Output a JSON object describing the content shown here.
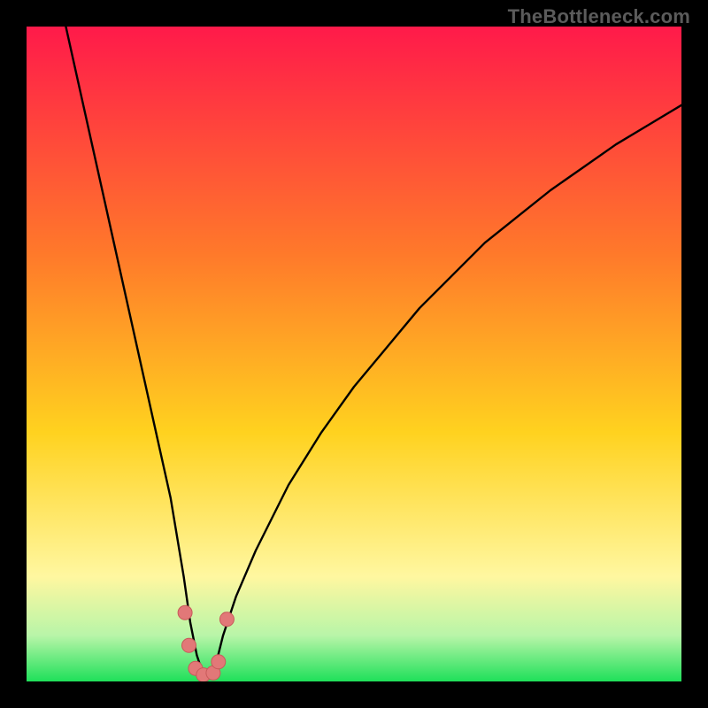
{
  "watermark": "TheBottleneck.com",
  "colors": {
    "frame": "#000000",
    "grad_top": "#ff1a4a",
    "grad_mid_upper": "#ff7a2a",
    "grad_mid": "#ffd21f",
    "grad_yellow_pale": "#fff7a0",
    "grad_green_pale": "#b8f5a8",
    "grad_green": "#1fe05a",
    "curve": "#000000",
    "marker_fill": "#e27878",
    "marker_stroke": "#c85a5a"
  },
  "chart_data": {
    "type": "line",
    "title": "",
    "xlabel": "",
    "ylabel": "",
    "xlim": [
      0,
      100
    ],
    "ylim": [
      0,
      100
    ],
    "note": "Axes are unlabeled; x is arbitrary range 0–100, y is 0 (bottom, green) to 100 (top, red). Curve is a steep V with minimum near x≈27, shallower rise to the right.",
    "series": [
      {
        "name": "bottleneck-curve",
        "x": [
          6,
          8,
          10,
          12,
          14,
          16,
          18,
          20,
          22,
          24,
          25,
          26,
          27,
          28,
          29,
          30,
          32,
          35,
          40,
          45,
          50,
          55,
          60,
          65,
          70,
          75,
          80,
          85,
          90,
          95,
          100
        ],
        "y": [
          100,
          91,
          82,
          73,
          64,
          55,
          46,
          37,
          28,
          16,
          9,
          4,
          1,
          1,
          3,
          7,
          13,
          20,
          30,
          38,
          45,
          51,
          57,
          62,
          67,
          71,
          75,
          78.5,
          82,
          85,
          88
        ]
      }
    ],
    "markers": [
      {
        "x": 24.2,
        "y": 10.5
      },
      {
        "x": 24.8,
        "y": 5.5
      },
      {
        "x": 25.8,
        "y": 2.0
      },
      {
        "x": 27.0,
        "y": 1.0
      },
      {
        "x": 28.5,
        "y": 1.3
      },
      {
        "x": 29.3,
        "y": 3.0
      },
      {
        "x": 30.6,
        "y": 9.5
      }
    ]
  }
}
